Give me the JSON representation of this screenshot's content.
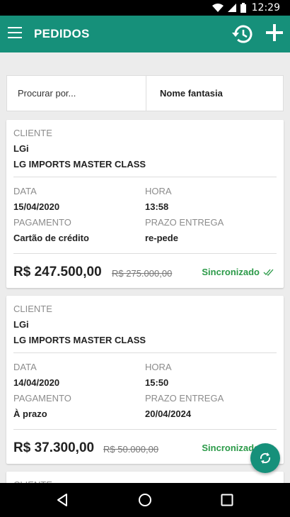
{
  "status_bar": {
    "time": "12:29"
  },
  "app_bar": {
    "title": "PEDIDOS"
  },
  "search": {
    "placeholder": "Procurar por...",
    "filter_label": "Nome fantasia"
  },
  "labels": {
    "cliente": "CLIENTE",
    "data": "DATA",
    "hora": "HORA",
    "pagamento": "PAGAMENTO",
    "prazo_entrega": "PRAZO ENTREGA"
  },
  "orders": [
    {
      "client_code": "LGi",
      "client_name": "LG IMPORTS MASTER CLASS",
      "date": "15/04/2020",
      "time": "13:58",
      "payment": "Cartão de crédito",
      "delivery": "re-pede",
      "total": "R$ 247.500,00",
      "original_total": "R$ 275.000,00",
      "status": "Sincronizado"
    },
    {
      "client_code": "LGi",
      "client_name": "LG IMPORTS MASTER CLASS",
      "date": "14/04/2020",
      "time": "15:50",
      "payment": "À prazo",
      "delivery": "20/04/2024",
      "total": "R$ 37.300,00",
      "original_total": "R$ 50.000,00",
      "status": "Sincronizado"
    }
  ],
  "partial_card": {
    "label": "CLIENTE"
  },
  "colors": {
    "primary": "#16907a",
    "synced": "#2b9a48"
  }
}
